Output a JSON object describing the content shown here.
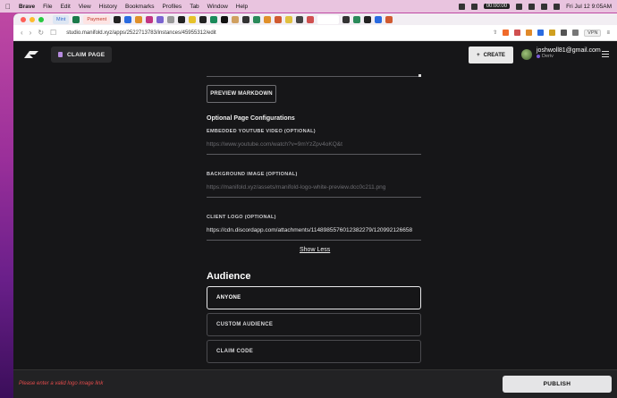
{
  "menubar": {
    "app": "Brave",
    "items": [
      "File",
      "Edit",
      "View",
      "History",
      "Bookmarks",
      "Profiles",
      "Tab",
      "Window",
      "Help"
    ],
    "recording": "00:00:00",
    "datetime": "Fri Jul 12  9:05AM"
  },
  "browser": {
    "tabs": [
      {
        "label": "Mint"
      },
      {
        "label": "Payment"
      }
    ],
    "url": "studio.manifold.xyz/apps/2522713783/instances/45955312/edit",
    "vpn_label": "VPN"
  },
  "header": {
    "claim_page": "CLAIM PAGE",
    "create_label": "CREATE",
    "create_plus": "+",
    "user_email": "joshwoll81@gmail.com",
    "network": "Deriv"
  },
  "form": {
    "preview_button": "PREVIEW MARKDOWN",
    "optional_title": "Optional Page Configurations",
    "youtube_label": "EMBEDDED YOUTUBE VIDEO (OPTIONAL)",
    "youtube_placeholder": "https://www.youtube.com/watch?v=9mYzZpv4oKQ&t",
    "background_label": "BACKGROUND IMAGE (OPTIONAL)",
    "background_placeholder": "https://manifold.xyz/assets/manifold-logo-white-preview.dcc0c211.png",
    "client_logo_label": "CLIENT LOGO (OPTIONAL)",
    "client_logo_value": "https://cdn.discordapp.com/attachments/1148985576012382279/120992126658",
    "show_less": "Show Less"
  },
  "audience": {
    "title": "Audience",
    "options": [
      "ANYONE",
      "CUSTOM AUDIENCE",
      "CLAIM CODE"
    ],
    "selected": "ANYONE"
  },
  "footer": {
    "error": "Please enter a valid logo image link",
    "publish_label": "PUBLISH"
  },
  "colors": {
    "background": "#161618",
    "error": "#e24b4b",
    "button_light": "#e5e5e7"
  }
}
